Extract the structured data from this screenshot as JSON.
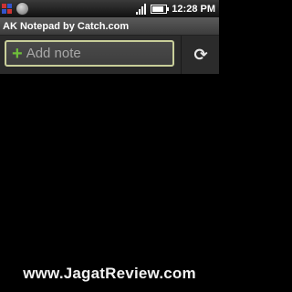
{
  "statusbar": {
    "time": "12:28 PM",
    "icons": [
      "notification-icon",
      "android-icon",
      "signal-icon",
      "battery-icon"
    ]
  },
  "app": {
    "title": "AK Notepad by Catch.com"
  },
  "toolbar": {
    "add_note_label": "Add note",
    "sync_icon": "sync-icon"
  },
  "watermark": {
    "text": "www.JagatReview.com"
  },
  "colors": {
    "accent_green": "#6fbf3a",
    "input_border": "#c9cf9a",
    "background": "#000000"
  }
}
